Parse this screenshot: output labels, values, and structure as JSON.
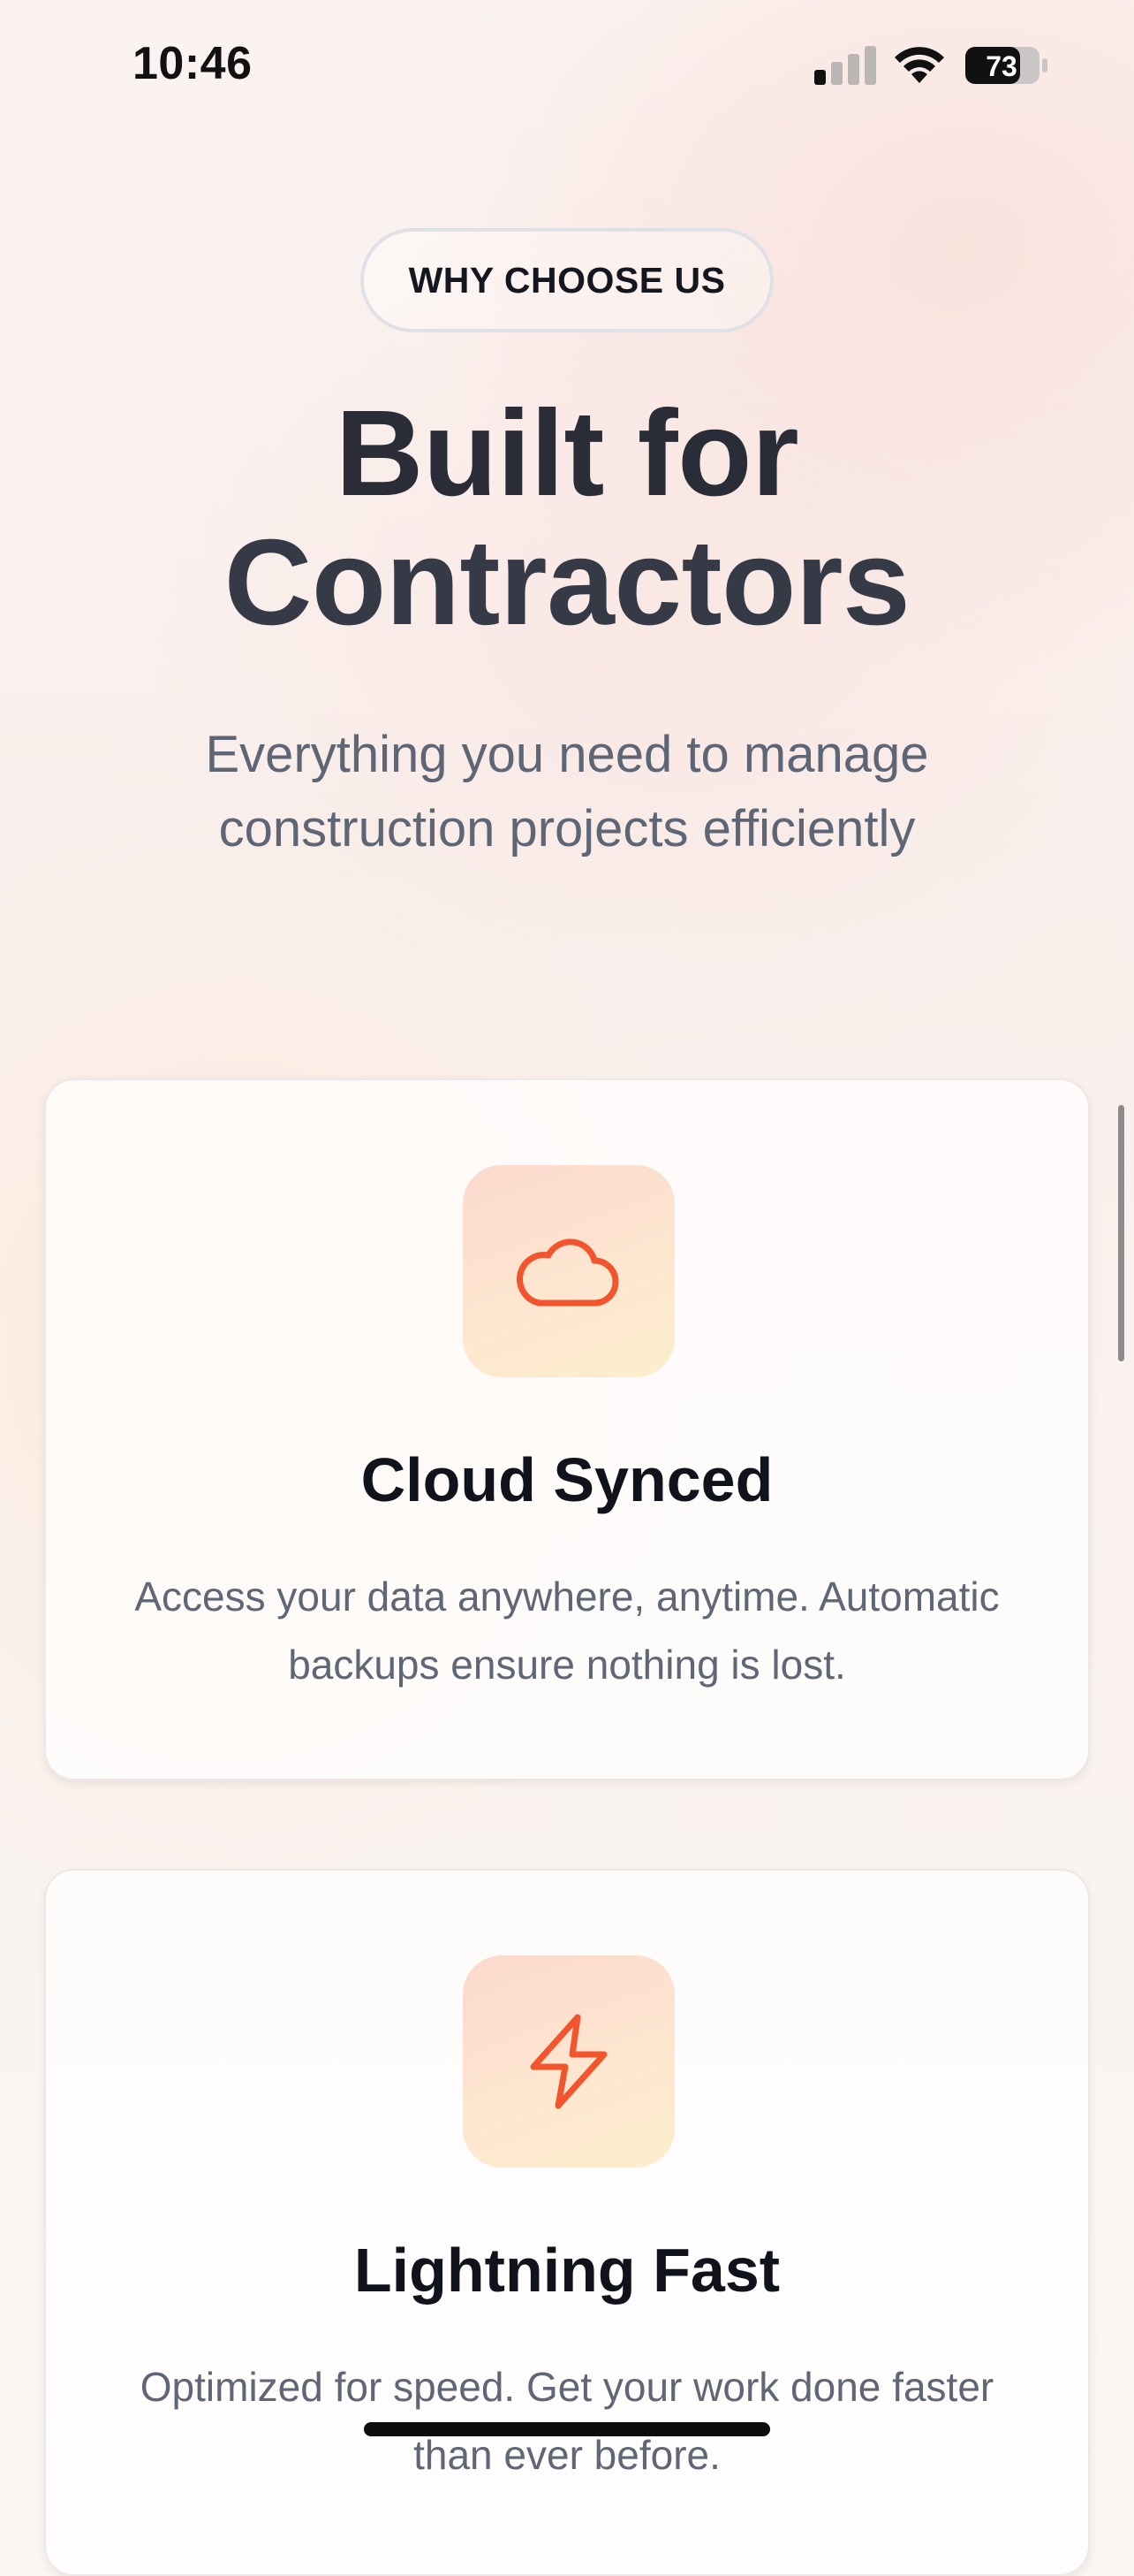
{
  "status_bar": {
    "time": "10:46",
    "battery": "73"
  },
  "header": {
    "badge": "WHY CHOOSE US",
    "headline_line1": "Built for",
    "headline_line2": "Contractors",
    "subtitle": "Everything you need to manage construction projects efficiently"
  },
  "features": [
    {
      "icon": "cloud-icon",
      "title": "Cloud Synced",
      "description": "Access your data anywhere, anytime. Automatic backups ensure nothing is lost."
    },
    {
      "icon": "lightning-icon",
      "title": "Lightning Fast",
      "description": "Optimized for speed. Get your work done faster than ever before."
    }
  ],
  "colors": {
    "accent": "#f2542d",
    "heading": "#2a2d38",
    "body_text": "#5f6776"
  }
}
